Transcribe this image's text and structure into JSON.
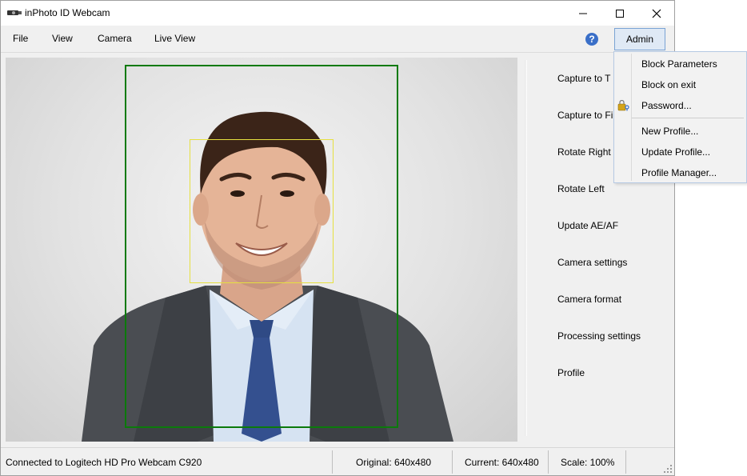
{
  "window": {
    "title": "inPhoto ID Webcam"
  },
  "menu": {
    "items": [
      {
        "label": "File"
      },
      {
        "label": "View"
      },
      {
        "label": "Camera"
      },
      {
        "label": "Live View"
      }
    ],
    "help_icon": "?",
    "admin_label": "Admin"
  },
  "side_panel": {
    "buttons": [
      {
        "label": "Capture to T"
      },
      {
        "label": "Capture to Fi"
      },
      {
        "label": "Rotate Right"
      },
      {
        "label": "Rotate Left"
      },
      {
        "label": "Update AE/AF"
      },
      {
        "label": "Camera settings"
      },
      {
        "label": "Camera format"
      },
      {
        "label": "Processing settings"
      },
      {
        "label": "Profile"
      }
    ]
  },
  "admin_menu": {
    "items": [
      {
        "label": "Block Parameters"
      },
      {
        "label": "Block on exit"
      },
      {
        "label": "Password...",
        "icon": "key-lock-icon"
      },
      {
        "label": "New Profile..."
      },
      {
        "label": "Update Profile..."
      },
      {
        "label": "Profile Manager..."
      }
    ]
  },
  "status": {
    "connection": "Connected to Logitech HD Pro Webcam C920",
    "original": "Original: 640x480",
    "current": "Current: 640x480",
    "scale": "Scale: 100%"
  },
  "colors": {
    "guide_outer": "#0b7a0b",
    "guide_face": "#e6e040",
    "admin_highlight": "#dfe9f5",
    "help_icon": "#3a6fc8"
  }
}
